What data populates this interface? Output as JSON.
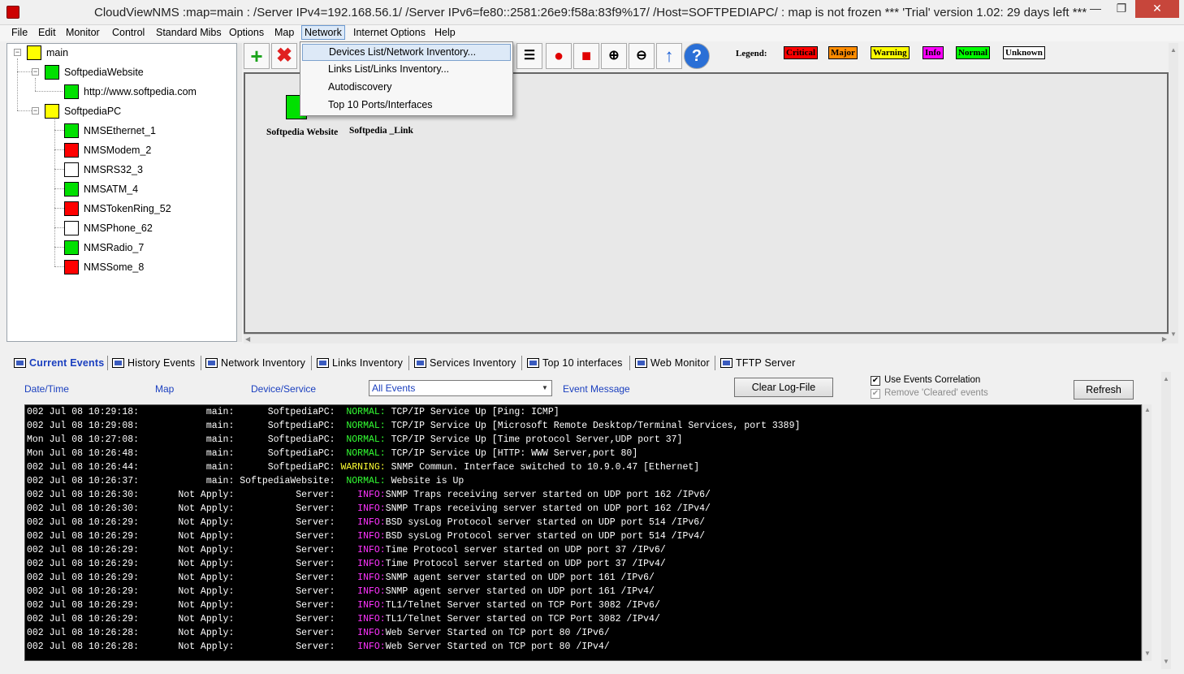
{
  "window": {
    "title": "CloudViewNMS :map=main :  /Server IPv4=192.168.56.1/ /Server IPv6=fe80::2581:26e9:f58a:83f9%17/ /Host=SOFTPEDIAPC/  : map is not frozen        *** 'Trial' version 1.02: 29 days left ***",
    "min_glyph": "—",
    "max_glyph": "❐",
    "close_glyph": "✕"
  },
  "menubar": [
    "File",
    "Edit",
    "Monitor",
    "Control",
    "Standard Mibs",
    "Options",
    "Map",
    "Network",
    "Internet Options",
    "Help"
  ],
  "network_menu": {
    "items": [
      "Devices List/Network Inventory...",
      "Links List/Links Inventory...",
      "Autodiscovery",
      "Top 10 Ports/Interfaces"
    ]
  },
  "tree": {
    "root": "main",
    "groups": [
      {
        "label": "SoftpediaWebsite",
        "children": [
          {
            "label": "http://www.softpedia.com",
            "status": "normal"
          }
        ]
      },
      {
        "label": "SoftpediaPC",
        "children": [
          {
            "label": "NMSEthernet_1",
            "status": "normal"
          },
          {
            "label": "NMSModem_2",
            "status": "critical"
          },
          {
            "label": "NMSRS32_3",
            "status": "unknown"
          },
          {
            "label": "NMSATM_4",
            "status": "normal"
          },
          {
            "label": "NMSTokenRing_52",
            "status": "critical"
          },
          {
            "label": "NMSPhone_62",
            "status": "unknown"
          },
          {
            "label": "NMSRadio_7",
            "status": "normal"
          },
          {
            "label": "NMSSome_8",
            "status": "critical"
          }
        ]
      }
    ]
  },
  "toolbar": {
    "legend_label": "Legend:",
    "legend": [
      {
        "label": "Critical",
        "color": "#ff0000"
      },
      {
        "label": "Major",
        "color": "#ff8c00"
      },
      {
        "label": "Warning",
        "color": "#ffff00"
      },
      {
        "label": "Info",
        "color": "#ff00ff"
      },
      {
        "label": "Normal",
        "color": "#00ff00"
      },
      {
        "label": "Unknown",
        "color": "#ffffff"
      }
    ]
  },
  "map": {
    "node_label": "Softpedia Website",
    "link_label": "Softpedia _Link"
  },
  "tabs": [
    "Current Events",
    "History Events",
    "Network Inventory",
    "Links Inventory",
    "Services Inventory",
    "Top 10 interfaces",
    "Web Monitor",
    "TFTP Server"
  ],
  "events": {
    "columns": {
      "datetime": "Date/Time",
      "map": "Map",
      "device": "Device/Service",
      "message": "Event Message"
    },
    "filter_selected": "All Events",
    "clear_button": "Clear Log-File",
    "refresh_button": "Refresh",
    "use_correlation": "Use Events Correlation",
    "remove_cleared": "Remove 'Cleared' events",
    "rows": [
      {
        "t": "002 Jul 08 10:29:18:",
        "map": "main:",
        "dev": "SoftpediaPC:",
        "lvl": "NORMAL:",
        "kind": "normal",
        "msg": "TCP/IP Service Up [Ping: ICMP]"
      },
      {
        "t": "002 Jul 08 10:29:08:",
        "map": "main:",
        "dev": "SoftpediaPC:",
        "lvl": "NORMAL:",
        "kind": "normal",
        "msg": "TCP/IP Service Up [Microsoft Remote Desktop/Terminal Services, port 3389]"
      },
      {
        "t": "Mon Jul 08 10:27:08:",
        "map": "main:",
        "dev": "SoftpediaPC:",
        "lvl": "NORMAL:",
        "kind": "normal",
        "msg": "TCP/IP Service Up [Time protocol Server,UDP port 37]"
      },
      {
        "t": "Mon Jul 08 10:26:48:",
        "map": "main:",
        "dev": "SoftpediaPC:",
        "lvl": "NORMAL:",
        "kind": "normal",
        "msg": "TCP/IP Service Up [HTTP: WWW Server,port 80]"
      },
      {
        "t": "002 Jul 08 10:26:44:",
        "map": "main:",
        "dev": "SoftpediaPC:",
        "lvl": "WARNING:",
        "kind": "warning",
        "msg": "SNMP Commun. Interface switched to 10.9.0.47 [Ethernet]"
      },
      {
        "t": "002 Jul 08 10:26:37:",
        "map": "main:",
        "dev": "SoftpediaWebsite:",
        "lvl": "NORMAL:",
        "kind": "normal",
        "msg": "Website is Up"
      },
      {
        "t": "002 Jul 08 10:26:30:",
        "map": "Not Apply:",
        "dev": "Server:",
        "lvl": "INFO:",
        "kind": "info",
        "msg": "SNMP Traps receiving server started on UDP port 162 /IPv6/"
      },
      {
        "t": "002 Jul 08 10:26:30:",
        "map": "Not Apply:",
        "dev": "Server:",
        "lvl": "INFO:",
        "kind": "info",
        "msg": "SNMP Traps receiving server started on UDP port 162 /IPv4/"
      },
      {
        "t": "002 Jul 08 10:26:29:",
        "map": "Not Apply:",
        "dev": "Server:",
        "lvl": "INFO:",
        "kind": "info",
        "msg": "BSD sysLog Protocol server started on UDP port 514 /IPv6/"
      },
      {
        "t": "002 Jul 08 10:26:29:",
        "map": "Not Apply:",
        "dev": "Server:",
        "lvl": "INFO:",
        "kind": "info",
        "msg": "BSD sysLog Protocol server started on UDP port 514 /IPv4/"
      },
      {
        "t": "002 Jul 08 10:26:29:",
        "map": "Not Apply:",
        "dev": "Server:",
        "lvl": "INFO:",
        "kind": "info",
        "msg": "Time Protocol server started on UDP port 37 /IPv6/"
      },
      {
        "t": "002 Jul 08 10:26:29:",
        "map": "Not Apply:",
        "dev": "Server:",
        "lvl": "INFO:",
        "kind": "info",
        "msg": "Time Protocol server started on UDP port 37 /IPv4/"
      },
      {
        "t": "002 Jul 08 10:26:29:",
        "map": "Not Apply:",
        "dev": "Server:",
        "lvl": "INFO:",
        "kind": "info",
        "msg": "SNMP agent server started on UDP port 161 /IPv6/"
      },
      {
        "t": "002 Jul 08 10:26:29:",
        "map": "Not Apply:",
        "dev": "Server:",
        "lvl": "INFO:",
        "kind": "info",
        "msg": "SNMP agent server started on UDP port 161 /IPv4/"
      },
      {
        "t": "002 Jul 08 10:26:29:",
        "map": "Not Apply:",
        "dev": "Server:",
        "lvl": "INFO:",
        "kind": "info",
        "msg": "TL1/Telnet Server started on TCP Port 3082 /IPv6/"
      },
      {
        "t": "002 Jul 08 10:26:29:",
        "map": "Not Apply:",
        "dev": "Server:",
        "lvl": "INFO:",
        "kind": "info",
        "msg": "TL1/Telnet Server started on TCP Port 3082 /IPv4/"
      },
      {
        "t": "002 Jul 08 10:26:28:",
        "map": "Not Apply:",
        "dev": "Server:",
        "lvl": "INFO:",
        "kind": "info",
        "msg": "Web Server Started on TCP port 80 /IPv6/"
      },
      {
        "t": "002 Jul 08 10:26:28:",
        "map": "Not Apply:",
        "dev": "Server:",
        "lvl": "INFO:",
        "kind": "info",
        "msg": "Web Server Started on TCP port 80 /IPv4/"
      }
    ]
  },
  "colors": {
    "critical": "#ff0000",
    "normal": "#00e000",
    "unknown": "#ffffff",
    "link_blue": "#1a3fbf"
  }
}
